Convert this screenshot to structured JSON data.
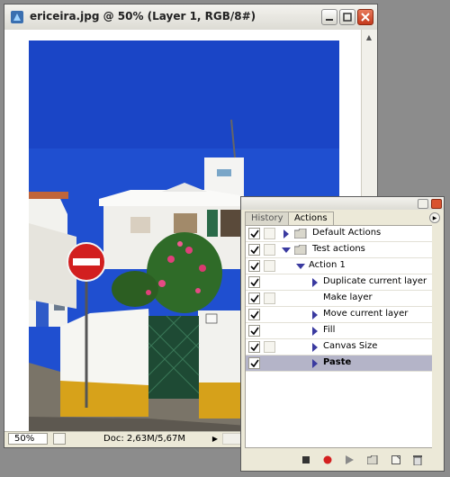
{
  "document_window": {
    "title": "ericeira.jpg @ 50% (Layer 1, RGB/8#)",
    "zoom": "50%",
    "doc_info": "Doc: 2,63M/5,67M"
  },
  "palette": {
    "tabs": [
      {
        "label": "History",
        "active": false
      },
      {
        "label": "Actions",
        "active": true
      }
    ],
    "actions": [
      {
        "label": "Default Actions",
        "kind": "set",
        "expanded": false,
        "checked": true,
        "selected": false
      },
      {
        "label": "Test actions",
        "kind": "set",
        "expanded": true,
        "checked": true,
        "selected": false
      },
      {
        "label": "Action 1",
        "kind": "action",
        "expanded": true,
        "checked": true,
        "selected": false
      },
      {
        "label": "Duplicate current layer",
        "kind": "step",
        "expandable": true,
        "checked": true,
        "selected": false
      },
      {
        "label": "Make layer",
        "kind": "step",
        "expandable": false,
        "checked": true,
        "selected": false
      },
      {
        "label": "Move current layer",
        "kind": "step",
        "expandable": true,
        "checked": true,
        "selected": false
      },
      {
        "label": "Fill",
        "kind": "step",
        "expandable": true,
        "checked": true,
        "selected": false
      },
      {
        "label": "Canvas Size",
        "kind": "step",
        "expandable": true,
        "checked": true,
        "selected": false
      },
      {
        "label": "Paste",
        "kind": "step",
        "expandable": true,
        "checked": true,
        "selected": true
      }
    ],
    "footer_buttons": [
      "stop-icon",
      "record-icon",
      "play-icon",
      "new-set-icon",
      "new-action-icon",
      "delete-icon"
    ]
  },
  "colors": {
    "selection": "#b4b4c8",
    "record": "#d42020",
    "sky": "#1f4fd0"
  }
}
